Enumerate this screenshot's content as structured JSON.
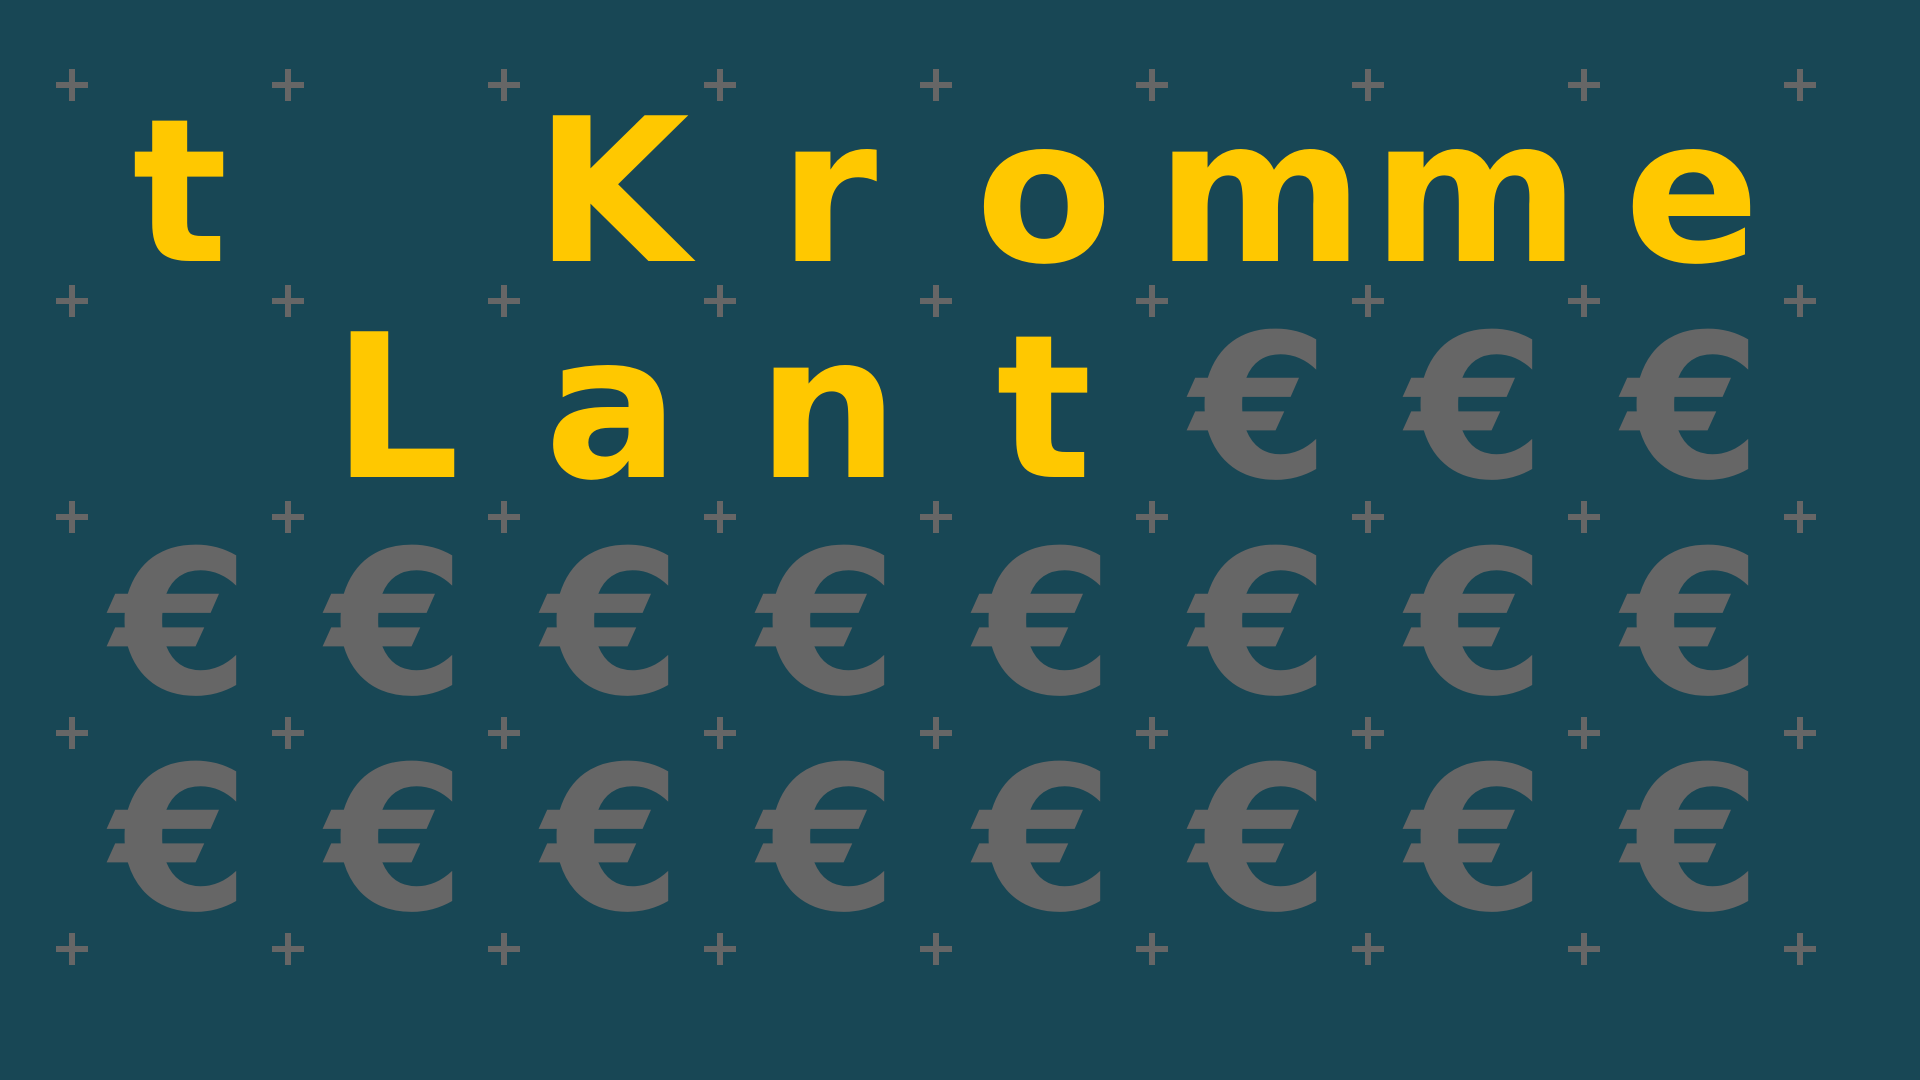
{
  "colors": {
    "background": "#184755",
    "letter": "#ffc800",
    "symbol": "#666666"
  },
  "grid": [
    [
      "t",
      "",
      "K",
      "r",
      "o",
      "m",
      "m",
      "e"
    ],
    [
      "",
      "L",
      "a",
      "n",
      "t",
      "€",
      "€",
      "€"
    ],
    [
      "€",
      "€",
      "€",
      "€",
      "€",
      "€",
      "€",
      "€"
    ],
    [
      "€",
      "€",
      "€",
      "€",
      "€",
      "€",
      "€",
      "€"
    ]
  ],
  "plus_icon": "plus-icon"
}
